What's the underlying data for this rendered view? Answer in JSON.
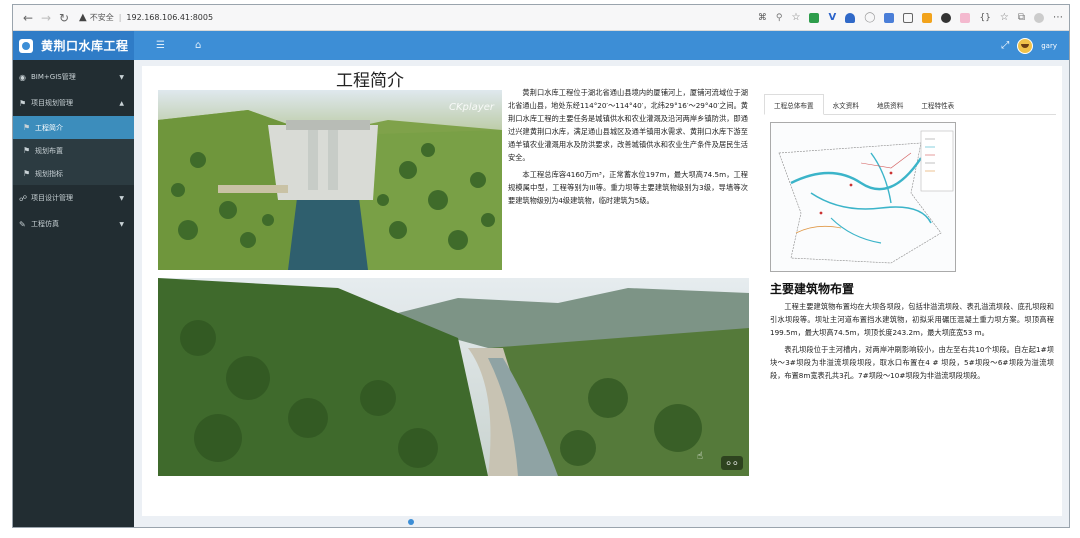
{
  "browser": {
    "security_label": "不安全",
    "url": "192.168.106.41:8005"
  },
  "app": {
    "title": "黄荆口水库工程",
    "username": "gary"
  },
  "sidebar": {
    "items": [
      {
        "label": "BIM+GIS管理",
        "icon": "globe-icon"
      },
      {
        "label": "项目规划管理",
        "icon": "flag-icon"
      },
      {
        "label": "项目设计管理",
        "icon": "share-icon"
      },
      {
        "label": "工程仿真",
        "icon": "wrench-icon"
      }
    ],
    "sub_items": [
      {
        "label": "工程简介",
        "active": true
      },
      {
        "label": "规划布置",
        "active": false
      },
      {
        "label": "规划指标",
        "active": false
      }
    ]
  },
  "page": {
    "title": "工程简介",
    "video_logo": "CKplayer",
    "intro_p1": "黄荆口水库工程位于湖北省通山县境内的厦铺河上，厦铺河流域位于湖北省通山县，地处东经114°20′～114°40′，北纬29°16′～29°40′之间。黄荆口水库工程的主要任务是城镇供水和农业灌溉及沿河两岸乡镇防洪，即通过兴建黄荆口水库，满足通山县城区及通羊镇用水需求、黄荆口水库下游至通羊镇农业灌溉用水及防洪要求，改善城镇供水和农业生产条件及居民生活安全。",
    "intro_p2": "本工程总库容4160万m³，正常蓄水位197m，最大坝高74.5m，工程规模属中型，工程等别为III等。重力坝等主要建筑物级别为3级，导墙等次要建筑物级别为4级建筑物，临时建筑为5级。",
    "tabs": [
      {
        "label": "工程总体布置",
        "active": true
      },
      {
        "label": "水文资料",
        "active": false
      },
      {
        "label": "地质资料",
        "active": false
      },
      {
        "label": "工程特性表",
        "active": false
      }
    ],
    "section_title": "主要建筑物布置",
    "section_p1": "工程主要建筑物布置均在大坝各坝段，包括非溢流坝段、表孔溢流坝段、底孔坝段和引水坝段等。坝址主河道布置挡水建筑物，初拟采用碾压混凝土重力坝方案。坝顶高程199.5m，最大坝高74.5m，坝顶长度243.2m，最大坝底宽53 m。",
    "section_p2": "表孔坝段位于主河槽内，对两岸冲刷影响较小，由左至右共10个坝段。自左起1#坝块～3#坝段为非溢流坝段坝段，取水口布置在4 # 坝段，5#坝段～6#坝段为溢流坝段，布置8m宽表孔共3孔。7#坝段～10#坝段为非溢流坝段坝段。"
  }
}
